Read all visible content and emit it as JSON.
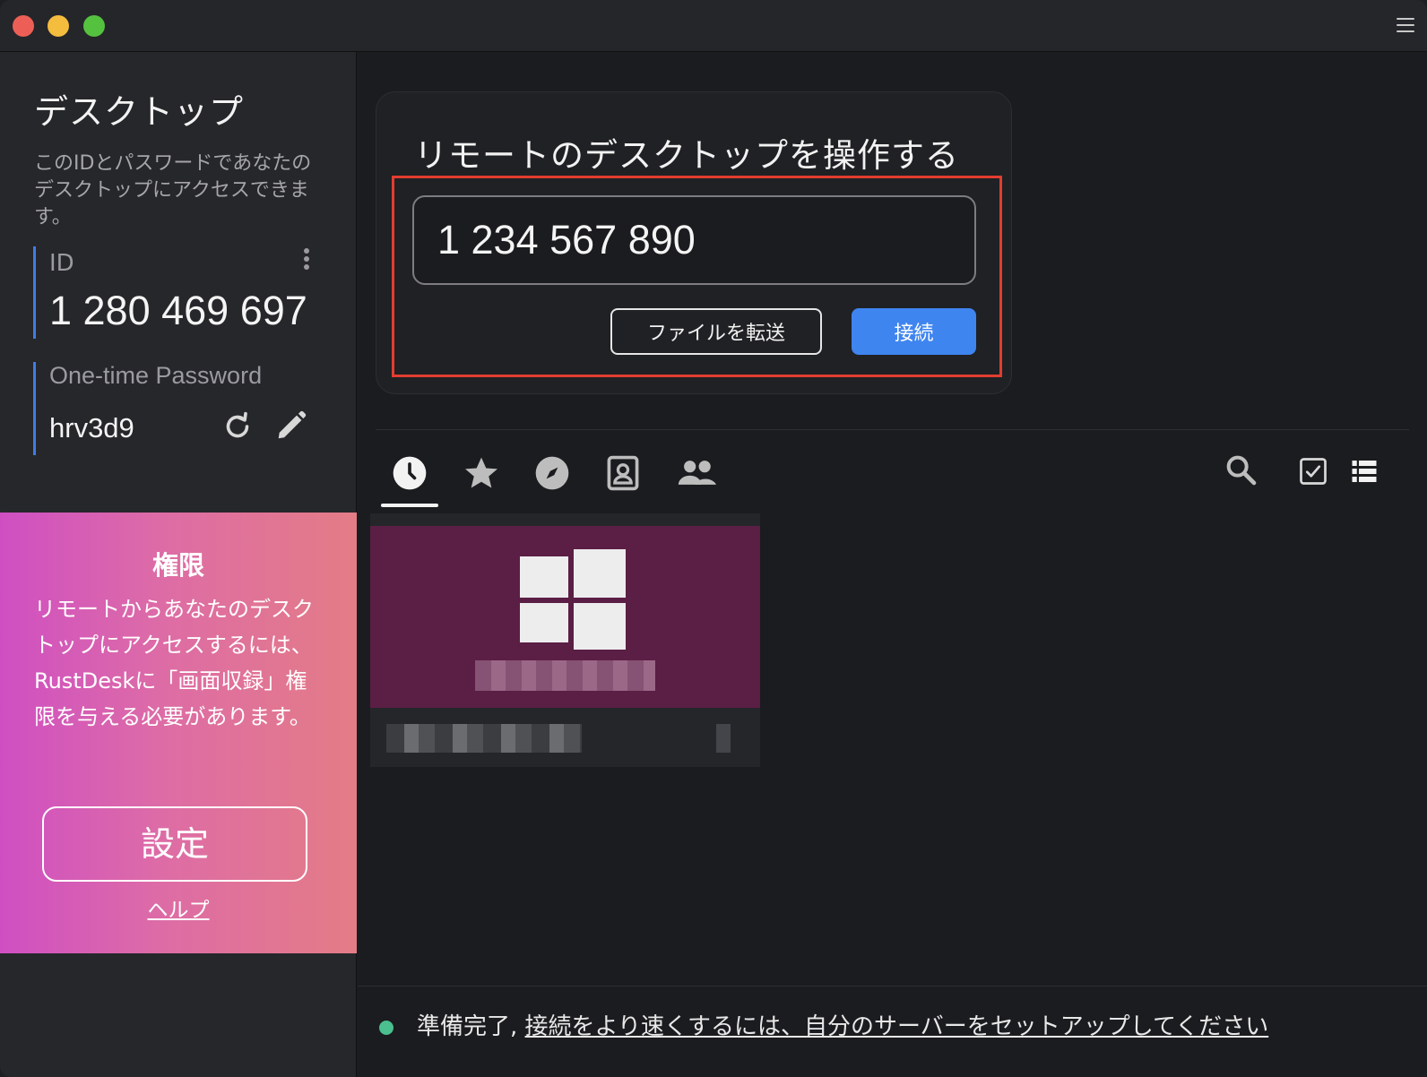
{
  "sidebar": {
    "title": "デスクトップ",
    "description": "このIDとパスワードであなたのデスクトップにアクセスできます。",
    "id_label": "ID",
    "id_value": "1 280 469 697",
    "password_label": "One-time Password",
    "password_value": "hrv3d9",
    "permission": {
      "title": "権限",
      "text": "リモートからあなたのデスクトップにアクセスするには、RustDeskに「画面収録」権限を与える必要があります。",
      "settings_label": "設定",
      "help_label": "ヘルプ"
    }
  },
  "connect": {
    "title": "リモートのデスクトップを操作する",
    "id_input_value": "1 234 567 890",
    "file_transfer_label": "ファイルを転送",
    "connect_label": "接続"
  },
  "tabs": [
    {
      "icon": "clock-icon",
      "name": "recent"
    },
    {
      "icon": "star-icon",
      "name": "favorites"
    },
    {
      "icon": "compass-icon",
      "name": "discovered"
    },
    {
      "icon": "address-book-icon",
      "name": "address-book"
    },
    {
      "icon": "group-icon",
      "name": "group"
    }
  ],
  "status": {
    "text": "準備完了,",
    "link": "接続をより速くするには、自分のサーバーをセットアップしてください"
  },
  "colors": {
    "accent": "#3f85f0",
    "highlight": "#e23d2f",
    "status_ok": "#4bbf8f",
    "permission_gradient_start": "#cf4fc3",
    "permission_gradient_end": "#e47c86"
  }
}
